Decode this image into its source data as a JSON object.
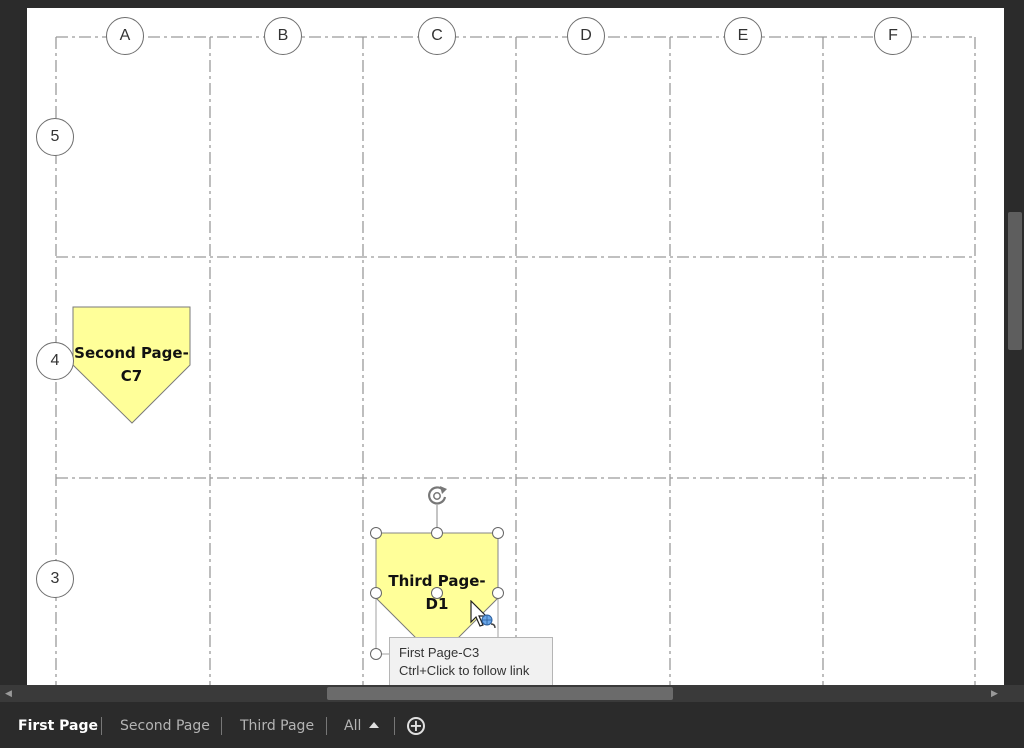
{
  "grid": {
    "columns": [
      "A",
      "B",
      "C",
      "D",
      "E",
      "F"
    ],
    "rows": [
      "5",
      "4",
      "3"
    ]
  },
  "shapes": [
    {
      "line1": "Second Page-",
      "line2": "C7",
      "fill": "#ffff99"
    },
    {
      "line1": "Third Page-",
      "line2": "D1",
      "fill": "#ffff99"
    }
  ],
  "tooltip": {
    "line1": "First Page-C3",
    "line2": "Ctrl+Click to follow link"
  },
  "tabs": {
    "first": "First Page",
    "second": "Second Page",
    "third": "Third Page",
    "all": "All"
  },
  "icons": {
    "rotate": "rotate-handle-icon",
    "cursor": "hyperlink-cursor-icon",
    "add": "add-page-icon",
    "all_menu": "triangle-up-icon"
  }
}
